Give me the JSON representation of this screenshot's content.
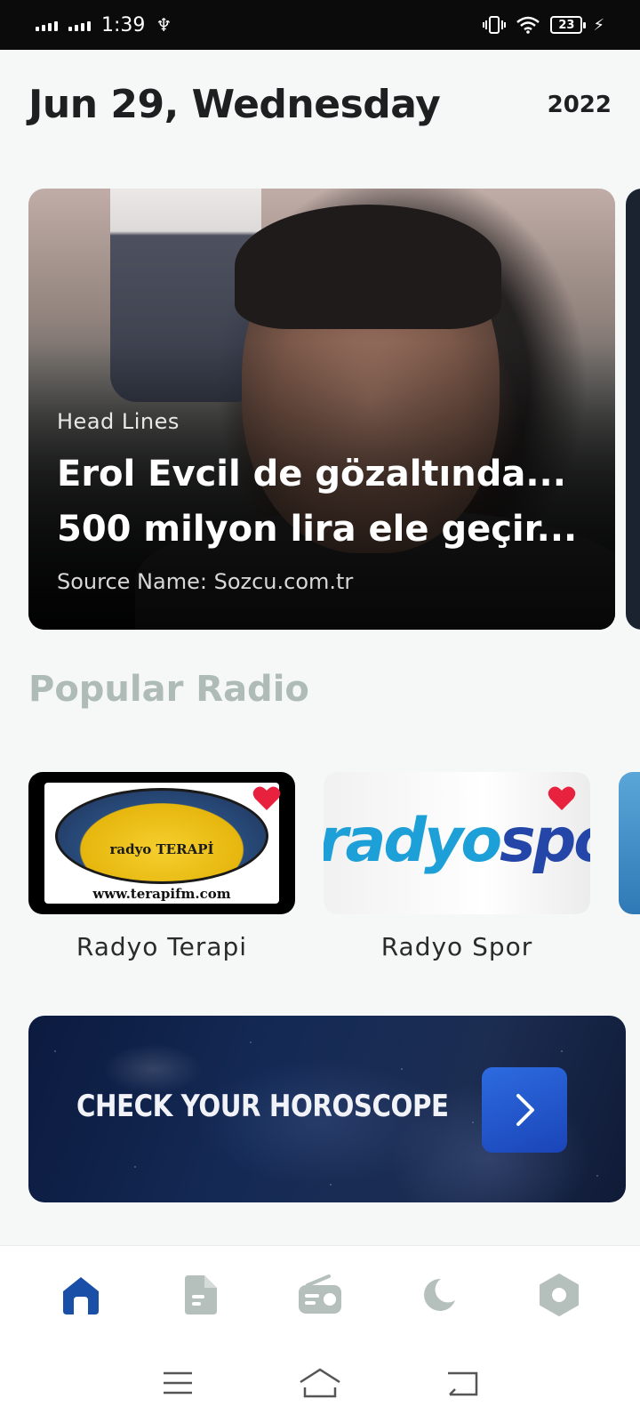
{
  "status_bar": {
    "time": "1:39",
    "battery": "23"
  },
  "header": {
    "date": "Jun 29, Wednesday",
    "year": "2022"
  },
  "headline": {
    "label": "Head Lines",
    "title": "Erol Evcil de gözaltında... 500 milyon lira ele geçir...",
    "source": "Source Name: Sozcu.com.tr"
  },
  "popular_radio": {
    "title": "Popular Radio",
    "items": [
      {
        "name": "Radyo Terapi",
        "logo_text": "radyo TERAPİ",
        "logo_url": "www.terapifm.com",
        "favorite": true
      },
      {
        "name": "Radyo Spor",
        "logo_text_a": "radyo",
        "logo_text_b": "spor",
        "favorite": true
      },
      {
        "name": "",
        "favorite": false
      }
    ]
  },
  "horoscope": {
    "label": "CHECK YOUR HOROSCOPE",
    "button_icon": "chevron-right-icon"
  },
  "bottom_nav": {
    "items": [
      {
        "icon": "home-icon",
        "active": true
      },
      {
        "icon": "document-icon",
        "active": false
      },
      {
        "icon": "radio-icon",
        "active": false
      },
      {
        "icon": "moon-icon",
        "active": false
      },
      {
        "icon": "settings-icon",
        "active": false
      }
    ]
  },
  "colors": {
    "accent": "#1a4fa8",
    "section_title": "#aebbb6",
    "nav_inactive": "#b5c0bc",
    "favorite": "#e8213f"
  }
}
